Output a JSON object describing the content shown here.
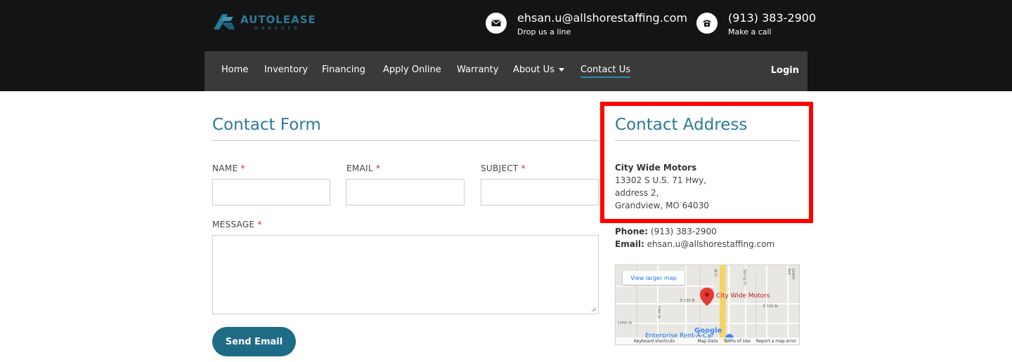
{
  "brand": {
    "name": "AUTOLEASE",
    "tagline": "MANAGER",
    "accent": "#2a7a97"
  },
  "header": {
    "email": {
      "main": "ehsan.u@allshorestaffing.com",
      "sub": "Drop us a line",
      "icon": "envelope-icon"
    },
    "phone": {
      "main": "(913) 383-2900",
      "sub": "Make a call",
      "icon": "phone-icon"
    }
  },
  "nav": {
    "items": [
      {
        "label": "Home"
      },
      {
        "label": "Inventory"
      },
      {
        "label": "Financing"
      },
      {
        "label": "Apply Online"
      },
      {
        "label": "Warranty"
      },
      {
        "label": "About Us",
        "dropdown": true
      },
      {
        "label": "Contact Us",
        "active": true
      }
    ],
    "login": "Login"
  },
  "contact_form": {
    "title": "Contact Form",
    "required_mark": "*",
    "name_label": "NAME",
    "email_label": "EMAIL",
    "subject_label": "SUBJECT",
    "message_label": "MESSAGE",
    "name_value": "",
    "email_value": "",
    "subject_value": "",
    "message_value": "",
    "send_label": "Send Email"
  },
  "contact_address": {
    "title": "Contact Address",
    "company": "City Wide Motors",
    "street": "13302 S U.S. 71 Hwy,",
    "address2": "address 2,",
    "city_state_zip": "Grandview, MO 64030",
    "phone_label": "Phone:",
    "phone_value": "(913) 383-2900",
    "email_label": "Email:",
    "email_value": "ehsan.u@allshorestaffing.com",
    "highlight_color": "#ff0000"
  },
  "map": {
    "view_larger": "View larger map",
    "marker_label": "City Wide Motors",
    "poi_label": "Enterprise Rent-A-Car",
    "street_labels": [
      "E 133 St",
      "E 133 St",
      "134th St",
      "13th St",
      "Spring St",
      "Lowell Ave",
      "W Fr"
    ],
    "google": "Google",
    "footer": [
      "Keyboard shortcuts",
      "Map Data",
      "Terms of Use",
      "Report a map error"
    ]
  }
}
